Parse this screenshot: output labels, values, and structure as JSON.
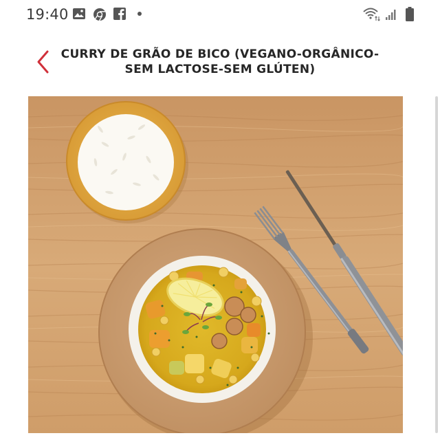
{
  "status_bar": {
    "time": "19:40",
    "left_icons": [
      "image-icon",
      "chrome-icon",
      "facebook-icon",
      "notification-dot-icon"
    ],
    "right_icons": [
      "wifi-icon",
      "signal-icon",
      "battery-icon"
    ]
  },
  "header": {
    "back_icon": "chevron-left-icon",
    "title_line1": "CURRY DE GRÃO DE BICO (VEGANO-ORGÂNICO-",
    "title_line2": "SEM LACTOSE-SEM GLÚTEN)"
  },
  "colors": {
    "accent": "#d0303a",
    "title_text": "#262626",
    "wood": "#d3a472"
  }
}
